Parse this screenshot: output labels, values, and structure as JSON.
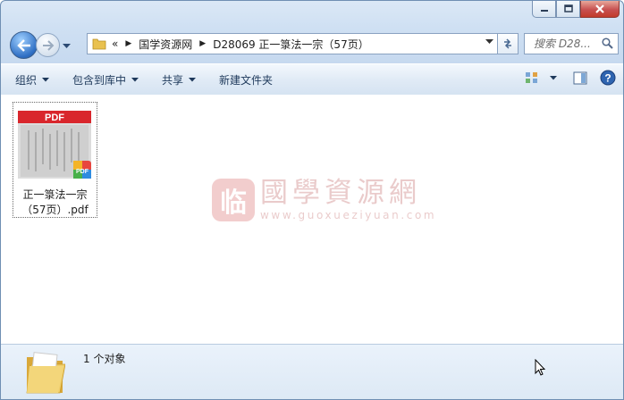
{
  "window": {
    "caption": {
      "minimize_icon": "minimize-icon",
      "maximize_icon": "maximize-icon",
      "close_icon": "close-icon"
    }
  },
  "address": {
    "overflow": "«",
    "breadcrumbs": [
      "国学资源网",
      "D28069 正一箓法一宗（57页）"
    ]
  },
  "search": {
    "placeholder": "搜索 D28..."
  },
  "toolbar": {
    "organize": "组织",
    "include_in_library": "包含到库中",
    "share": "共享",
    "new_folder": "新建文件夹"
  },
  "files": [
    {
      "name": "正一箓法一宗（57页）.pdf",
      "thumb_label": "PDF",
      "badge": "PDF"
    }
  ],
  "watermark": {
    "seal": "临",
    "chinese": "國學資源網",
    "english": "www.guoxueziyuan.com"
  },
  "details": {
    "count": "1 个对象"
  },
  "colors": {
    "pdf_red": "#d9262c",
    "accent": "#2f6fc4"
  }
}
